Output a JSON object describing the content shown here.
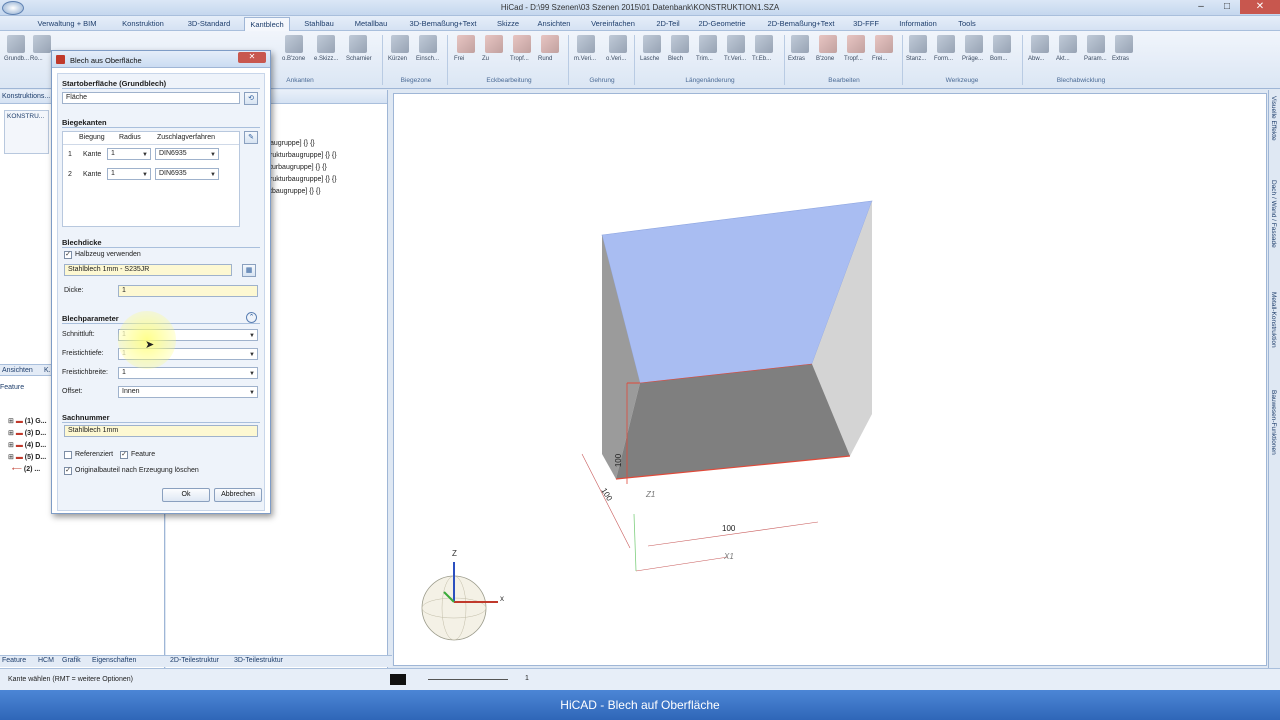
{
  "window": {
    "title": "HiCad - D:\\99 Szenen\\03 Szenen 2015\\01 Datenbank\\KONSTRUKTION1.SZA",
    "minimize": "–",
    "maximize": "□",
    "close": "✕"
  },
  "menu": {
    "tabs": [
      "Verwaltung + BIM",
      "Konstruktion",
      "3D-Standard",
      "Kantblech",
      "Stahlbau",
      "Metallbau",
      "3D-Bemaßung+Text",
      "Skizze",
      "Ansichten",
      "Vereinfachen",
      "2D-Teil",
      "2D-Geometrie",
      "2D-Bemaßung+Text",
      "3D-FFF",
      "Information",
      "Tools"
    ],
    "active": "Kantblech"
  },
  "ribbon": {
    "buttons": [
      "Grundb...",
      "Ro...",
      "o.B'zone",
      "e.Skizz...",
      "Scharnier",
      "Kürzen",
      "Einsch...",
      "Frei",
      "Zu",
      "Tropf...",
      "Rund",
      "m.Veri...",
      "o.Veri...",
      "Lasche",
      "Blech",
      "Trim...",
      "Tr.Veri...",
      "Tr.Eb...",
      "Extras",
      "B'zone",
      "Tropf...",
      "Frei...",
      "Stanz...",
      "Form...",
      "Präge...",
      "Bom...",
      "Abw...",
      "Akt...",
      "Param...",
      "Extras"
    ],
    "groups": [
      "Ankanten",
      "Biegezone",
      "Eckbearbeitung",
      "Gehrung",
      "Längenänderung",
      "Bearbeiten",
      "Werkzeuge",
      "Blechabwicklung"
    ]
  },
  "left_panel": {
    "title": "Konstruktions...",
    "tab_label": "KONSTRU...",
    "tabs": [
      "Ansichten",
      "K..."
    ],
    "feature_label": "Feature",
    "tree": [
      "(1) G...",
      "(3) D...",
      "(4) D...",
      "(5) D...",
      "(2) ..."
    ]
  },
  "mid_panel": {
    "lines": [
      "augruppe] {} {}",
      "rukturbaugruppe] {} {}",
      "turbaugruppe] {} {}",
      "rukturbaugruppe] {} {}",
      "tbaugruppe] {} {}"
    ]
  },
  "dialog": {
    "title": "Blech aus Oberfläche",
    "close": "✕",
    "start_surface": {
      "title": "Startoberfläche (Grundblech)",
      "value": "Fläche"
    },
    "bends": {
      "title": "Biegekanten",
      "columns": [
        "Biegung",
        "Radius",
        "Zuschlagverfahren"
      ],
      "rows": [
        {
          "num": "1",
          "type": "Kante",
          "radius": "1",
          "method": "DIN6935"
        },
        {
          "num": "2",
          "type": "Kante",
          "radius": "1",
          "method": "DIN6935"
        }
      ]
    },
    "thickness": {
      "title": "Blechdicke",
      "semi_label": "Halbzeug verwenden",
      "semi_value": "Stahlblech 1mm - S235JR",
      "thickness_label": "Dicke:",
      "thickness_value": "1"
    },
    "params": {
      "title": "Blechparameter",
      "gap_label": "Schnittluft:",
      "gap_value": "1",
      "depth_label": "Freistichtiefe:",
      "depth_value": "1",
      "width_label": "Freistichbreite:",
      "width_value": "1",
      "offset_label": "Offset:",
      "offset_value": "Innen"
    },
    "part_number": {
      "title": "Sachnummer",
      "value": "Stahlblech 1mm"
    },
    "ref_label": "Referenziert",
    "feature_label": "Feature",
    "delete_label": "Originalbauteil nach Erzeugung löschen",
    "ok": "Ok",
    "cancel": "Abbrechen"
  },
  "viewport": {
    "dim_100_a": "100",
    "dim_100_b": "100",
    "dim_100_c": "100",
    "axis_z1": "Z1",
    "axis_x1": "X1",
    "axis_z": "Z",
    "axis_x": "x"
  },
  "right_tabs": [
    "Visuelle Effekte",
    "Dach / Wand / Fassade",
    "Metall-Konstruktion",
    "Bauwesen-Funktionen"
  ],
  "bottom_tabs": [
    "Feature",
    "HCM",
    "Grafik",
    "Eigenschaften",
    "2D-Teilestruktur",
    "3D-Teilestruktur"
  ],
  "status": {
    "text": "Kante wählen (RMT = weitere Optionen)",
    "line_value": "1"
  },
  "caption": "HiCAD - Blech auf Oberfläche"
}
